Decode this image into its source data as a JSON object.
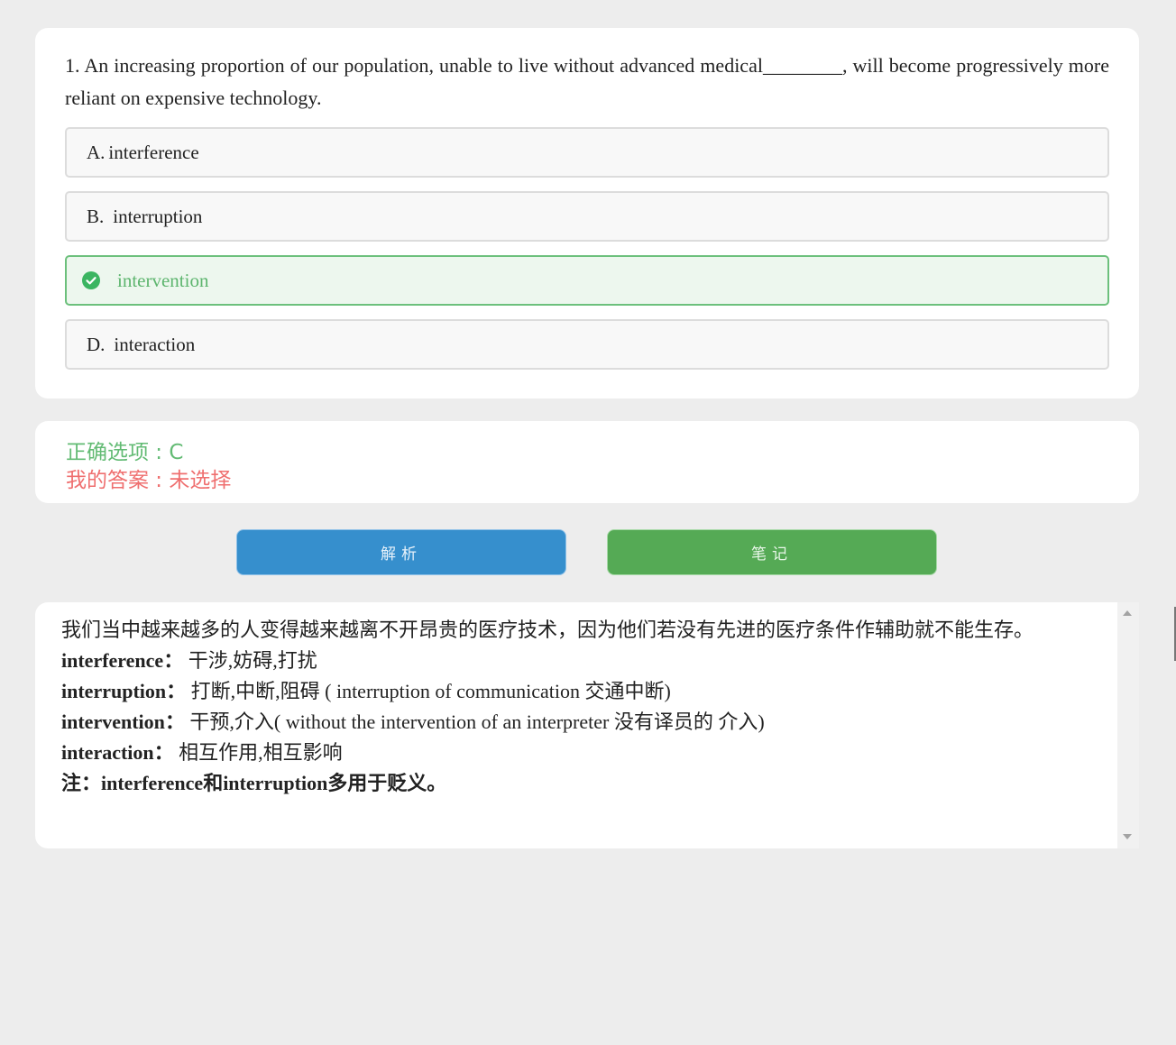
{
  "question": {
    "text": "1. An increasing proportion of our population, unable to live without advanced medical________, will become progressively more reliant on expensive technology.",
    "options": [
      {
        "letter": "A.",
        "text": "interference"
      },
      {
        "letter": "B.",
        "text": "interruption"
      },
      {
        "letter": "",
        "text": "intervention",
        "selected_icon": "check-circle-icon"
      },
      {
        "letter": "D.",
        "text": "interaction"
      }
    ]
  },
  "answer": {
    "correct": "正确选项 : C",
    "mine": "我的答案 : 未选择"
  },
  "buttons": {
    "analysis": "解析",
    "notes": "笔记"
  },
  "explanation": {
    "translation": "我们当中越来越多的人变得越来越离不开昂贵的医疗技术，因为他们若没有先进的医疗条件作辅助就不能生存。",
    "entries": [
      {
        "term": "interference：",
        "meaning": " 干涉,妨碍,打扰"
      },
      {
        "term": "interruption：",
        "meaning": " 打断,中断,阻碍 ( interruption of communication 交通中断)"
      },
      {
        "term": "intervention：",
        "meaning": "  干预,介入( without the intervention of an interpreter 没有译员的 介入)"
      },
      {
        "term": "interaction：",
        "meaning": " 相互作用,相互影响"
      }
    ],
    "note": "注：interference和interruption多用于贬义。"
  },
  "colors": {
    "correct": "#63bb74",
    "wrong": "#ef6f6f",
    "analysis_button": "#368fcd",
    "notes_button": "#55aa55"
  }
}
